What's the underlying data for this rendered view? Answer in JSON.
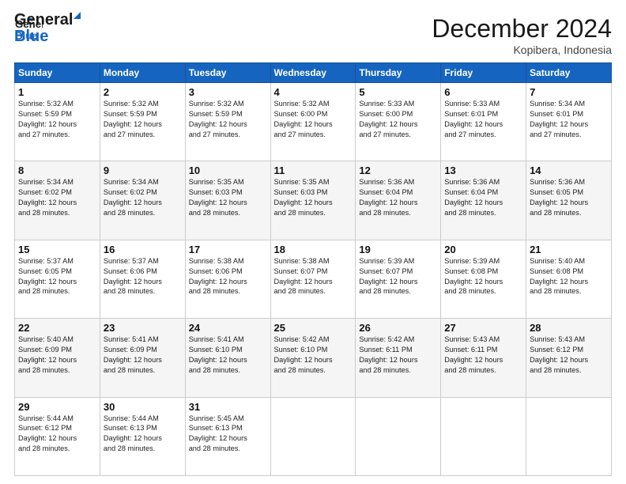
{
  "header": {
    "logo_line1": "General",
    "logo_line2": "Blue",
    "month": "December 2024",
    "location": "Kopibera, Indonesia"
  },
  "days_of_week": [
    "Sunday",
    "Monday",
    "Tuesday",
    "Wednesday",
    "Thursday",
    "Friday",
    "Saturday"
  ],
  "weeks": [
    [
      {
        "day": "1",
        "text": "Sunrise: 5:32 AM\nSunset: 5:59 PM\nDaylight: 12 hours\nand 27 minutes."
      },
      {
        "day": "2",
        "text": "Sunrise: 5:32 AM\nSunset: 5:59 PM\nDaylight: 12 hours\nand 27 minutes."
      },
      {
        "day": "3",
        "text": "Sunrise: 5:32 AM\nSunset: 5:59 PM\nDaylight: 12 hours\nand 27 minutes."
      },
      {
        "day": "4",
        "text": "Sunrise: 5:32 AM\nSunset: 6:00 PM\nDaylight: 12 hours\nand 27 minutes."
      },
      {
        "day": "5",
        "text": "Sunrise: 5:33 AM\nSunset: 6:00 PM\nDaylight: 12 hours\nand 27 minutes."
      },
      {
        "day": "6",
        "text": "Sunrise: 5:33 AM\nSunset: 6:01 PM\nDaylight: 12 hours\nand 27 minutes."
      },
      {
        "day": "7",
        "text": "Sunrise: 5:34 AM\nSunset: 6:01 PM\nDaylight: 12 hours\nand 27 minutes."
      }
    ],
    [
      {
        "day": "8",
        "text": "Sunrise: 5:34 AM\nSunset: 6:02 PM\nDaylight: 12 hours\nand 28 minutes."
      },
      {
        "day": "9",
        "text": "Sunrise: 5:34 AM\nSunset: 6:02 PM\nDaylight: 12 hours\nand 28 minutes."
      },
      {
        "day": "10",
        "text": "Sunrise: 5:35 AM\nSunset: 6:03 PM\nDaylight: 12 hours\nand 28 minutes."
      },
      {
        "day": "11",
        "text": "Sunrise: 5:35 AM\nSunset: 6:03 PM\nDaylight: 12 hours\nand 28 minutes."
      },
      {
        "day": "12",
        "text": "Sunrise: 5:36 AM\nSunset: 6:04 PM\nDaylight: 12 hours\nand 28 minutes."
      },
      {
        "day": "13",
        "text": "Sunrise: 5:36 AM\nSunset: 6:04 PM\nDaylight: 12 hours\nand 28 minutes."
      },
      {
        "day": "14",
        "text": "Sunrise: 5:36 AM\nSunset: 6:05 PM\nDaylight: 12 hours\nand 28 minutes."
      }
    ],
    [
      {
        "day": "15",
        "text": "Sunrise: 5:37 AM\nSunset: 6:05 PM\nDaylight: 12 hours\nand 28 minutes."
      },
      {
        "day": "16",
        "text": "Sunrise: 5:37 AM\nSunset: 6:06 PM\nDaylight: 12 hours\nand 28 minutes."
      },
      {
        "day": "17",
        "text": "Sunrise: 5:38 AM\nSunset: 6:06 PM\nDaylight: 12 hours\nand 28 minutes."
      },
      {
        "day": "18",
        "text": "Sunrise: 5:38 AM\nSunset: 6:07 PM\nDaylight: 12 hours\nand 28 minutes."
      },
      {
        "day": "19",
        "text": "Sunrise: 5:39 AM\nSunset: 6:07 PM\nDaylight: 12 hours\nand 28 minutes."
      },
      {
        "day": "20",
        "text": "Sunrise: 5:39 AM\nSunset: 6:08 PM\nDaylight: 12 hours\nand 28 minutes."
      },
      {
        "day": "21",
        "text": "Sunrise: 5:40 AM\nSunset: 6:08 PM\nDaylight: 12 hours\nand 28 minutes."
      }
    ],
    [
      {
        "day": "22",
        "text": "Sunrise: 5:40 AM\nSunset: 6:09 PM\nDaylight: 12 hours\nand 28 minutes."
      },
      {
        "day": "23",
        "text": "Sunrise: 5:41 AM\nSunset: 6:09 PM\nDaylight: 12 hours\nand 28 minutes."
      },
      {
        "day": "24",
        "text": "Sunrise: 5:41 AM\nSunset: 6:10 PM\nDaylight: 12 hours\nand 28 minutes."
      },
      {
        "day": "25",
        "text": "Sunrise: 5:42 AM\nSunset: 6:10 PM\nDaylight: 12 hours\nand 28 minutes."
      },
      {
        "day": "26",
        "text": "Sunrise: 5:42 AM\nSunset: 6:11 PM\nDaylight: 12 hours\nand 28 minutes."
      },
      {
        "day": "27",
        "text": "Sunrise: 5:43 AM\nSunset: 6:11 PM\nDaylight: 12 hours\nand 28 minutes."
      },
      {
        "day": "28",
        "text": "Sunrise: 5:43 AM\nSunset: 6:12 PM\nDaylight: 12 hours\nand 28 minutes."
      }
    ],
    [
      {
        "day": "29",
        "text": "Sunrise: 5:44 AM\nSunset: 6:12 PM\nDaylight: 12 hours\nand 28 minutes."
      },
      {
        "day": "30",
        "text": "Sunrise: 5:44 AM\nSunset: 6:13 PM\nDaylight: 12 hours\nand 28 minutes."
      },
      {
        "day": "31",
        "text": "Sunrise: 5:45 AM\nSunset: 6:13 PM\nDaylight: 12 hours\nand 28 minutes."
      },
      {
        "day": "",
        "text": ""
      },
      {
        "day": "",
        "text": ""
      },
      {
        "day": "",
        "text": ""
      },
      {
        "day": "",
        "text": ""
      }
    ]
  ]
}
